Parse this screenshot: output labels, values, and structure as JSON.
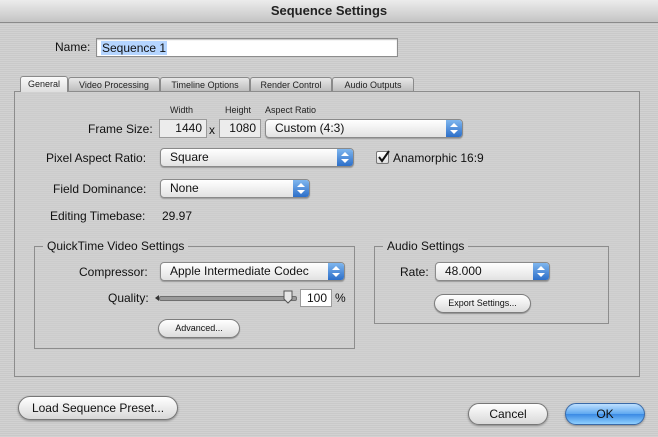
{
  "window": {
    "title": "Sequence Settings"
  },
  "name_field": {
    "label": "Name:",
    "value": "Sequence 1"
  },
  "tabs": [
    {
      "label": "General",
      "active": true
    },
    {
      "label": "Video Processing",
      "active": false
    },
    {
      "label": "Timeline Options",
      "active": false
    },
    {
      "label": "Render Control",
      "active": false
    },
    {
      "label": "Audio Outputs",
      "active": false
    }
  ],
  "general": {
    "frame_size": {
      "label": "Frame Size:",
      "width_header": "Width",
      "height_header": "Height",
      "aspect_header": "Aspect Ratio",
      "width": "1440",
      "separator": "x",
      "height": "1080",
      "aspect_ratio": "Custom (4:3)"
    },
    "pixel_aspect_ratio": {
      "label": "Pixel Aspect Ratio:",
      "value": "Square"
    },
    "anamorphic": {
      "label": "Anamorphic 16:9",
      "checked": true
    },
    "field_dominance": {
      "label": "Field Dominance:",
      "value": "None"
    },
    "editing_timebase": {
      "label": "Editing Timebase:",
      "value": "29.97"
    }
  },
  "quicktime": {
    "title": "QuickTime Video Settings",
    "compressor_label": "Compressor:",
    "compressor_value": "Apple Intermediate Codec",
    "quality_label": "Quality:",
    "quality_value": "100",
    "quality_unit": "%",
    "quality_level": 1.0,
    "advanced_button": "Advanced..."
  },
  "audio": {
    "title": "Audio Settings",
    "rate_label": "Rate:",
    "rate_value": "48.000",
    "export_button": "Export Settings..."
  },
  "footer": {
    "load_preset_button": "Load Sequence Preset...",
    "cancel_button": "Cancel",
    "ok_button": "OK"
  },
  "colors": {
    "accent": "#3a8ae4",
    "selection": "#b5d5ff"
  },
  "icons": [
    "popup-arrows-icon",
    "checkmark-icon",
    "slider-thumb-icon"
  ]
}
